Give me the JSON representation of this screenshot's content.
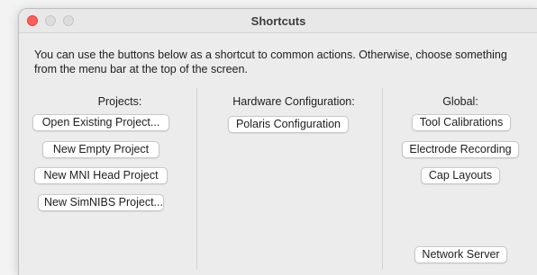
{
  "window": {
    "title": "Shortcuts"
  },
  "intro_text": "You can use the buttons below as a shortcut to common actions. Otherwise, choose something from the menu bar at the top of the screen.",
  "columns": {
    "projects": {
      "heading": "Projects:",
      "buttons": [
        "Open Existing Project...",
        "New Empty Project",
        "New MNI Head Project",
        "New SimNIBS Project..."
      ]
    },
    "hardware": {
      "heading": "Hardware Configuration:",
      "buttons": [
        "Polaris Configuration"
      ]
    },
    "global": {
      "heading": "Global:",
      "buttons": [
        "Tool Calibrations",
        "Electrode Recording",
        "Cap Layouts",
        "Network Server"
      ]
    }
  },
  "colors": {
    "close_button": "#fe5f57",
    "window_background": "#ececec"
  }
}
